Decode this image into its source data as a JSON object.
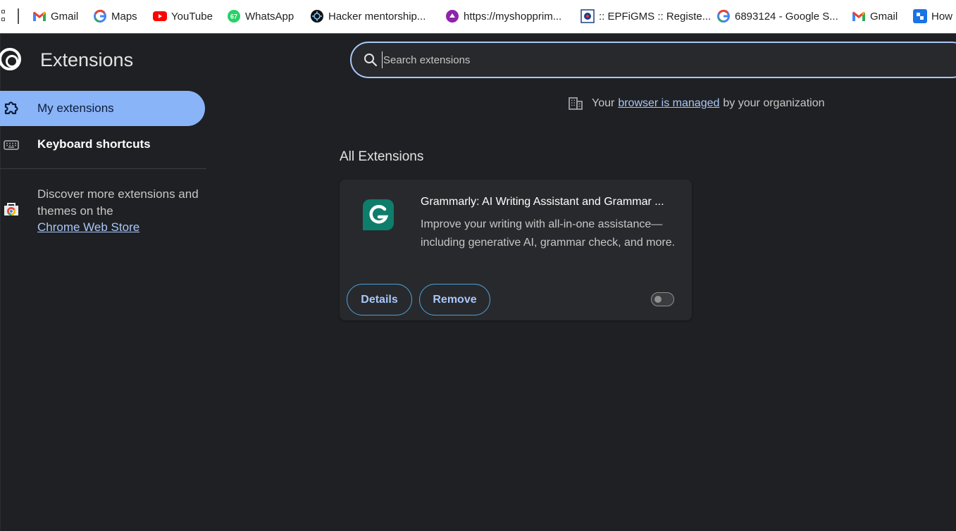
{
  "bookmarks": [
    {
      "label": "Gmail",
      "icon": "gmail-icon",
      "color": "#EA4335"
    },
    {
      "label": "Maps",
      "icon": "google-icon",
      "color": "#4285F4"
    },
    {
      "label": "YouTube",
      "icon": "youtube-icon",
      "color": "#FF0000"
    },
    {
      "label": "WhatsApp",
      "icon": "whatsapp-icon",
      "color": "#25D366",
      "badge": "67"
    },
    {
      "label": "Hacker mentorship...",
      "icon": "hacker-icon",
      "color": "#111111"
    },
    {
      "label": "https://myshopprim...",
      "icon": "myshop-icon",
      "color": "#8E24AA"
    },
    {
      "label": ":: EPFiGMS :: Registe...",
      "icon": "epfo-icon",
      "color": "#1A3E8C"
    },
    {
      "label": "6893124 - Google S...",
      "icon": "google-icon",
      "color": "#4285F4"
    },
    {
      "label": "Gmail",
      "icon": "gmail-icon",
      "color": "#EA4335"
    },
    {
      "label": "How",
      "icon": "how-icon",
      "color": "#1A73E8"
    }
  ],
  "sidebar": {
    "title": "Extensions",
    "items": [
      {
        "label": "My extensions",
        "icon": "puzzle-icon",
        "active": true
      },
      {
        "label": "Keyboard shortcuts",
        "icon": "keyboard-icon",
        "active": false
      }
    ],
    "discover_text": "Discover more extensions and themes on the",
    "store_link": "Chrome Web Store"
  },
  "search": {
    "placeholder": "Search extensions",
    "value": ""
  },
  "managed": {
    "prefix": "Your",
    "link": "browser is managed",
    "suffix": "by your organization"
  },
  "section_title": "All Extensions",
  "extension": {
    "name": "Grammarly: AI Writing Assistant and Grammar ...",
    "description": "Improve your writing with all-in-one assistance—including generative AI, grammar check, and more.",
    "details_label": "Details",
    "remove_label": "Remove",
    "enabled": false,
    "logo_letter": "G",
    "logo_color": "#0E7D6B"
  },
  "colors": {
    "background": "#1F2023",
    "card": "#28292C",
    "accent": "#8AB4F8",
    "link": "#A8C7FA"
  }
}
